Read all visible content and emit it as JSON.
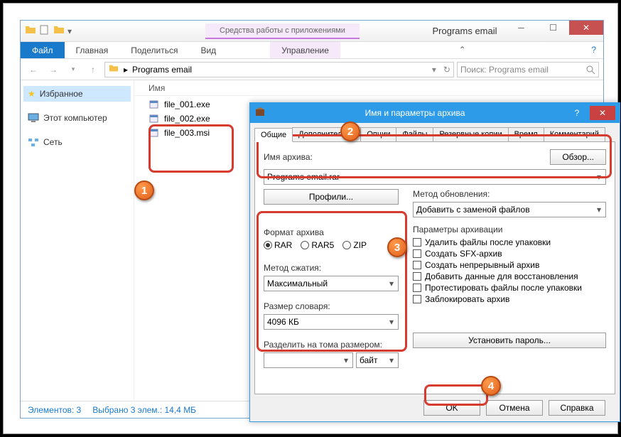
{
  "title_tools": "Средства работы с приложениями",
  "window_title": "Programs email",
  "tabs": {
    "file": "Файл",
    "home": "Главная",
    "share": "Поделиться",
    "view": "Вид",
    "manage": "Управление"
  },
  "breadcrumb": "Programs email",
  "search_placeholder": "Поиск: Programs email",
  "nav": {
    "favorites": "Избранное",
    "thispc": "Этот компьютер",
    "network": "Сеть"
  },
  "column_name": "Имя",
  "files": [
    {
      "name": "file_001.exe"
    },
    {
      "name": "file_002.exe"
    },
    {
      "name": "file_003.msi"
    }
  ],
  "status": {
    "items": "Элементов: 3",
    "selected": "Выбрано 3 элем.: 14,4 МБ"
  },
  "dialog": {
    "title": "Имя и параметры архива",
    "tabs": {
      "general": "Общие",
      "advanced": "Дополнительно",
      "options": "Опции",
      "files": "Файлы",
      "backup": "Резервные копии",
      "time": "Время",
      "comment": "Комментарий"
    },
    "archive_name_label": "Имя архива:",
    "browse": "Обзор...",
    "archive_name": "Programs email.rar",
    "profiles": "Профили...",
    "update_label": "Метод обновления:",
    "update_value": "Добавить с заменой файлов",
    "format_label": "Формат архива",
    "formats": {
      "rar": "RAR",
      "rar5": "RAR5",
      "zip": "ZIP"
    },
    "compression_label": "Метод сжатия:",
    "compression_value": "Максимальный",
    "dict_label": "Размер словаря:",
    "dict_value": "4096 КБ",
    "split_label": "Разделить на тома размером:",
    "split_unit": "байт",
    "params_label": "Параметры архивации",
    "opts": {
      "del": "Удалить файлы после упаковки",
      "sfx": "Создать SFX-архив",
      "solid": "Создать непрерывный архив",
      "recovery": "Добавить данные для восстановления",
      "test": "Протестировать файлы после упаковки",
      "lock": "Заблокировать архив"
    },
    "password": "Установить пароль...",
    "ok": "OK",
    "cancel": "Отмена",
    "help": "Справка"
  }
}
